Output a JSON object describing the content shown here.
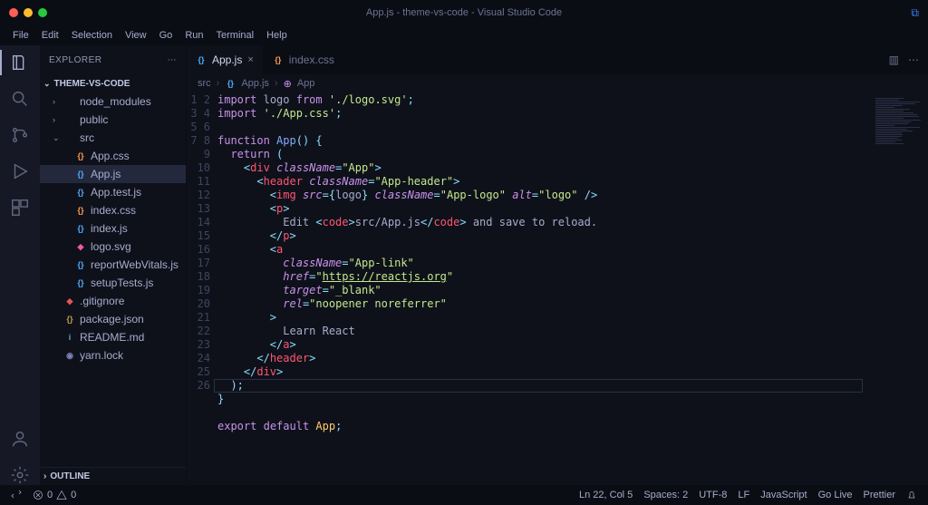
{
  "title": "App.js - theme-vs-code - Visual Studio Code",
  "menu": [
    "File",
    "Edit",
    "Selection",
    "View",
    "Go",
    "Run",
    "Terminal",
    "Help"
  ],
  "sidebar": {
    "header": "EXPLORER",
    "project": "THEME-VS-CODE",
    "outline": "OUTLINE",
    "tree": [
      {
        "depth": 1,
        "kind": "folder",
        "label": "node_modules",
        "tw": "›"
      },
      {
        "depth": 1,
        "kind": "folder",
        "label": "public",
        "tw": "›"
      },
      {
        "depth": 1,
        "kind": "folder",
        "label": "src",
        "tw": "⌄"
      },
      {
        "depth": 2,
        "kind": "css",
        "label": "App.css"
      },
      {
        "depth": 2,
        "kind": "js",
        "label": "App.js",
        "selected": true
      },
      {
        "depth": 2,
        "kind": "test",
        "label": "App.test.js"
      },
      {
        "depth": 2,
        "kind": "css",
        "label": "index.css"
      },
      {
        "depth": 2,
        "kind": "js",
        "label": "index.js"
      },
      {
        "depth": 2,
        "kind": "svg",
        "label": "logo.svg"
      },
      {
        "depth": 2,
        "kind": "js",
        "label": "reportWebVitals.js"
      },
      {
        "depth": 2,
        "kind": "js",
        "label": "setupTests.js"
      },
      {
        "depth": 1,
        "kind": "git",
        "label": ".gitignore"
      },
      {
        "depth": 1,
        "kind": "json",
        "label": "package.json"
      },
      {
        "depth": 1,
        "kind": "md",
        "label": "README.md"
      },
      {
        "depth": 1,
        "kind": "yarn",
        "label": "yarn.lock"
      }
    ]
  },
  "tabs": [
    {
      "label": "App.js",
      "icon": "js",
      "active": true
    },
    {
      "label": "index.css",
      "icon": "css",
      "active": false
    }
  ],
  "breadcrumb": [
    "src",
    "App.js",
    "App"
  ],
  "code_lines": [
    {
      "n": 1,
      "html": "<span class='tok-kw'>import</span> <span class='tok-id'>logo</span> <span class='tok-kw'>from</span> <span class='tok-str'>'./logo.svg'</span><span class='tok-punc'>;</span>"
    },
    {
      "n": 2,
      "html": "<span class='tok-kw'>import</span> <span class='tok-str'>'./App.css'</span><span class='tok-punc'>;</span>"
    },
    {
      "n": 3,
      "html": ""
    },
    {
      "n": 4,
      "html": "<span class='tok-kw'>function</span> <span class='tok-fn'>App</span><span class='tok-punc'>()</span> <span class='tok-punc'>{</span>"
    },
    {
      "n": 5,
      "html": "  <span class='tok-kw'>return</span> <span class='tok-punc'>(</span>"
    },
    {
      "n": 6,
      "html": "    <span class='tok-punc'>&lt;</span><span class='tok-tag'>div</span> <span class='tok-attr'>className</span><span class='tok-punc'>=</span><span class='tok-str'>\"App\"</span><span class='tok-punc'>&gt;</span>"
    },
    {
      "n": 7,
      "html": "      <span class='tok-punc'>&lt;</span><span class='tok-tag'>header</span> <span class='tok-attr'>className</span><span class='tok-punc'>=</span><span class='tok-str'>\"App-header\"</span><span class='tok-punc'>&gt;</span>"
    },
    {
      "n": 8,
      "html": "        <span class='tok-punc'>&lt;</span><span class='tok-tag'>img</span> <span class='tok-attr'>src</span><span class='tok-punc'>=</span><span class='tok-punc'>{</span><span class='tok-id'>logo</span><span class='tok-punc'>}</span> <span class='tok-attr'>className</span><span class='tok-punc'>=</span><span class='tok-str'>\"App-logo\"</span> <span class='tok-attr'>alt</span><span class='tok-punc'>=</span><span class='tok-str'>\"logo\"</span> <span class='tok-punc'>/&gt;</span>"
    },
    {
      "n": 9,
      "html": "        <span class='tok-punc'>&lt;</span><span class='tok-tag'>p</span><span class='tok-punc'>&gt;</span>"
    },
    {
      "n": 10,
      "html": "          Edit <span class='tok-punc'>&lt;</span><span class='tok-tag'>code</span><span class='tok-punc'>&gt;</span>src/App.js<span class='tok-punc'>&lt;/</span><span class='tok-tag'>code</span><span class='tok-punc'>&gt;</span> and save to reload."
    },
    {
      "n": 11,
      "html": "        <span class='tok-punc'>&lt;/</span><span class='tok-tag'>p</span><span class='tok-punc'>&gt;</span>"
    },
    {
      "n": 12,
      "html": "        <span class='tok-punc'>&lt;</span><span class='tok-tag'>a</span>"
    },
    {
      "n": 13,
      "html": "          <span class='tok-attr'>className</span><span class='tok-punc'>=</span><span class='tok-str'>\"App-link\"</span>"
    },
    {
      "n": 14,
      "html": "          <span class='tok-attr'>href</span><span class='tok-punc'>=</span><span class='tok-str'>\"<span class='tok-url'>https://reactjs.org</span>\"</span>"
    },
    {
      "n": 15,
      "html": "          <span class='tok-attr'>target</span><span class='tok-punc'>=</span><span class='tok-str'>\"_blank\"</span>"
    },
    {
      "n": 16,
      "html": "          <span class='tok-attr'>rel</span><span class='tok-punc'>=</span><span class='tok-str'>\"noopener noreferrer\"</span>"
    },
    {
      "n": 17,
      "html": "        <span class='tok-punc'>&gt;</span>"
    },
    {
      "n": 18,
      "html": "          Learn React"
    },
    {
      "n": 19,
      "html": "        <span class='tok-punc'>&lt;/</span><span class='tok-tag'>a</span><span class='tok-punc'>&gt;</span>"
    },
    {
      "n": 20,
      "html": "      <span class='tok-punc'>&lt;/</span><span class='tok-tag'>header</span><span class='tok-punc'>&gt;</span>"
    },
    {
      "n": 21,
      "html": "    <span class='tok-punc'>&lt;/</span><span class='tok-tag'>div</span><span class='tok-punc'>&gt;</span>"
    },
    {
      "n": 22,
      "html": "  <span class='tok-punc'>);</span>",
      "current": true
    },
    {
      "n": 23,
      "html": "<span class='tok-punc'>}</span>"
    },
    {
      "n": 24,
      "html": ""
    },
    {
      "n": 25,
      "html": "<span class='tok-kw'>export</span> <span class='tok-kw'>default</span> <span class='tok-type'>App</span><span class='tok-punc'>;</span>"
    },
    {
      "n": 26,
      "html": ""
    }
  ],
  "status": {
    "left": {
      "errors": "0",
      "warnings": "0"
    },
    "right": [
      "Ln 22, Col 5",
      "Spaces: 2",
      "UTF-8",
      "LF",
      "JavaScript",
      "Go Live",
      "Prettier"
    ]
  },
  "icons": {
    "js_badge": "{}",
    "css_badge": "{}",
    "dots": "⋯",
    "split": "▥",
    "chev_right": "›",
    "chev_down": "⌄"
  }
}
